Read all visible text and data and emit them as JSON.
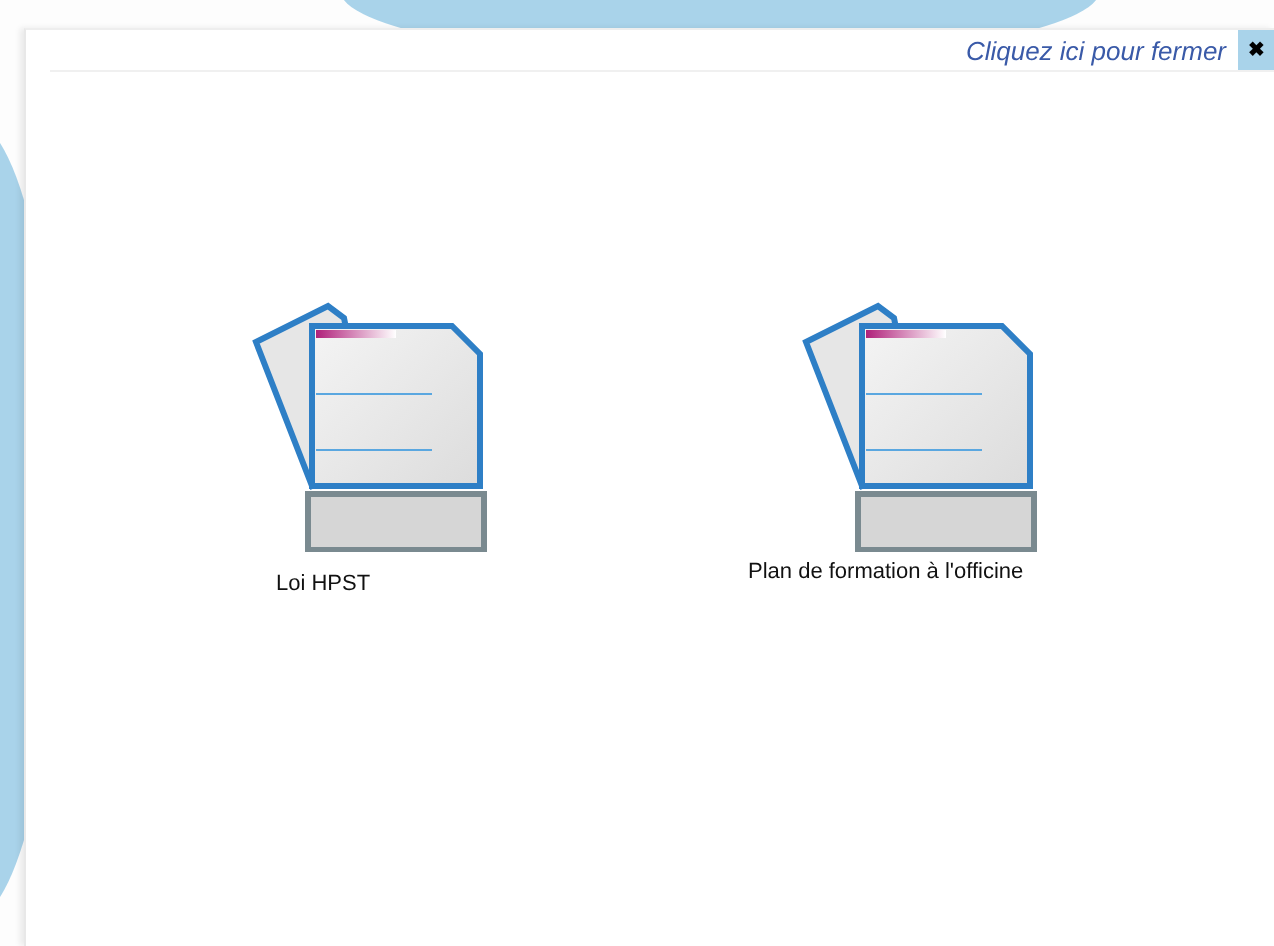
{
  "header": {
    "close_link": "Cliquez ici pour fermer",
    "close_button": "✖"
  },
  "documents": [
    {
      "label": "Loi HPST"
    },
    {
      "label": "Plan de formation à l'officine"
    }
  ]
}
